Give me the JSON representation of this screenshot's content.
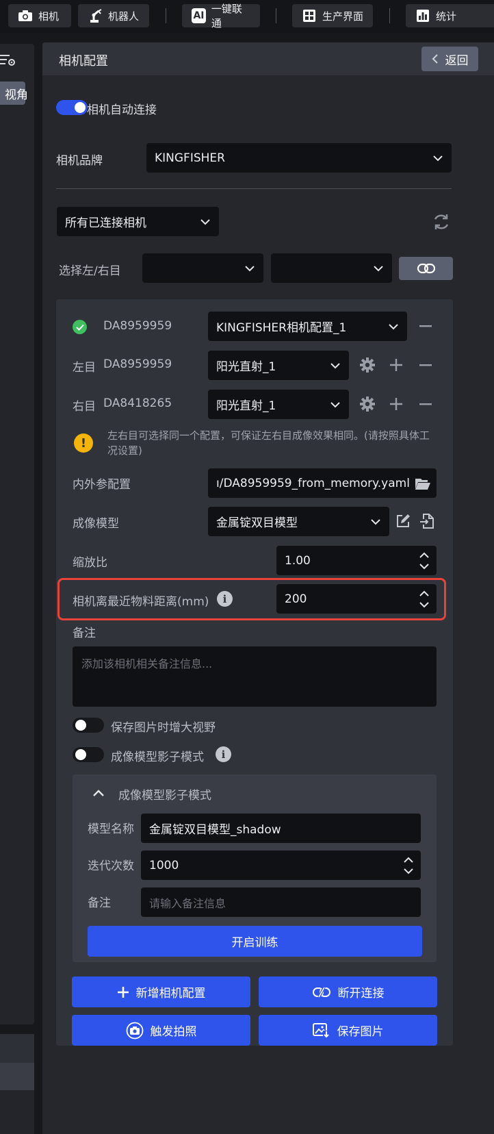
{
  "topbar": {
    "items": [
      {
        "label": "相机",
        "icon": "camera-icon"
      },
      {
        "label": "机器人",
        "icon": "robot-arm-icon"
      },
      {
        "label": "一键联通",
        "icon": "ai-icon",
        "icon_text": "AI"
      },
      {
        "label": "生产界面",
        "icon": "grid-icon"
      },
      {
        "label": "统计",
        "icon": "bar-chart-icon"
      }
    ]
  },
  "left_panel": {
    "view_button": "视角"
  },
  "panel": {
    "title": "相机配置",
    "back_label": "返回"
  },
  "auto_connect": {
    "label": "相机自动连接",
    "enabled": true
  },
  "brand": {
    "label": "相机品牌",
    "value": "KINGFISHER"
  },
  "connected": {
    "value": "所有已连接相机"
  },
  "select_eye": {
    "label": "选择左/右目",
    "left_value": "",
    "right_value": ""
  },
  "camera": {
    "id": "DA8959959",
    "status": "connected",
    "config": "KINGFISHER相机配置_1",
    "left": {
      "label": "左目",
      "id": "DA8959959",
      "profile": "阳光直射_1"
    },
    "right": {
      "label": "右目",
      "id": "DA8418265",
      "profile": "阳光直射_1"
    },
    "warning": "左右目可选择同一个配置，可保证左右目成像效果相同。(请按照具体工况设置)"
  },
  "params": {
    "calib_label": "内外参配置",
    "calib_value": "ı/DA8959959_from_memory.yaml",
    "model_label": "成像模型",
    "model_value": "金属锭双目模型",
    "scale_label": "缩放比",
    "scale_value": "1.00",
    "distance_label": "相机离最近物料距离(mm)",
    "distance_value": "200",
    "note_label": "备注",
    "note_placeholder": "添加该相机相关备注信息..."
  },
  "toggles": {
    "enlarge_label": "保存图片时增大视野",
    "enlarge_on": false,
    "shadow_label": "成像模型影子模式",
    "shadow_on": false
  },
  "shadow": {
    "header": "成像模型影子模式",
    "name_label": "模型名称",
    "name_value": "金属锭双目模型_shadow",
    "iter_label": "迭代次数",
    "iter_value": "1000",
    "note_label": "备注",
    "note_placeholder": "请输入备注信息",
    "train_label": "开启训练"
  },
  "actions": {
    "add_config": "新增相机配置",
    "disconnect": "断开连接",
    "trigger": "触发拍照",
    "save_image": "保存图片"
  },
  "colors": {
    "accent": "#2f54eb",
    "success": "#3fbf5f",
    "warning": "#f5b40a",
    "highlight": "#e8433a"
  }
}
